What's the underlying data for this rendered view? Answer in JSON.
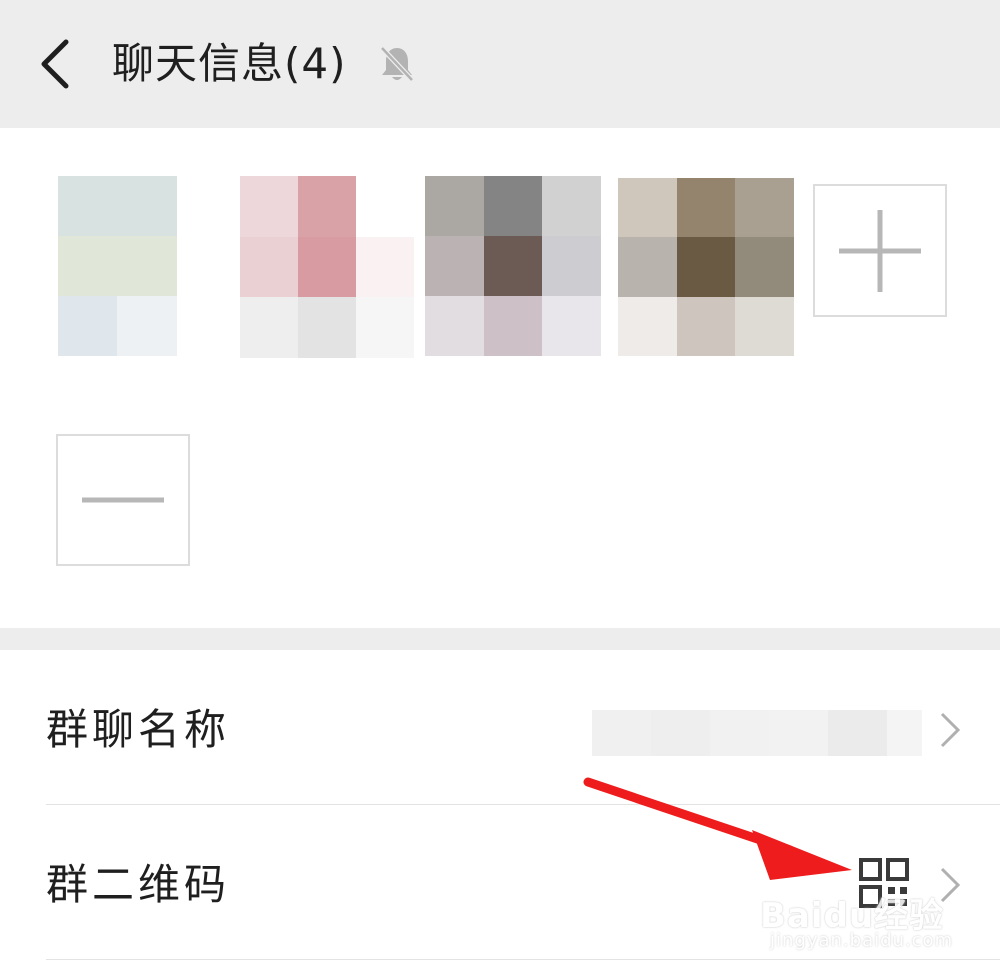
{
  "header": {
    "title": "聊天信息(4)",
    "back_icon": "chevron-left-icon",
    "mute_icon": "bell-muted-icon"
  },
  "members": {
    "add_icon": "plus-icon",
    "remove_icon": "minus-icon",
    "avatars": [
      {
        "colors": [
          "#d8e3e1",
          "#d8e3e1",
          "#ffffff",
          "#e0e6d8",
          "#e0e6d8",
          "#ffffff",
          "#dfe7ec",
          "#eef1f4",
          "#ffffff"
        ]
      },
      {
        "colors": [
          "#eed7da",
          "#d9a2a7",
          "#ffffff",
          "#ead0d3",
          "#d89ba1",
          "#faf1f2",
          "#efeeee",
          "#e3e3e3",
          "#f6f6f6"
        ]
      },
      {
        "colors": [
          "#aba7a2",
          "#848484",
          "#d1d1d1",
          "#bab2b3",
          "#6c5a54",
          "#cdccd0",
          "#e2dde0",
          "#cdc0c6",
          "#e8e6ea"
        ]
      },
      {
        "colors": [
          "#cfc6bc",
          "#94836d",
          "#a9a091",
          "#b9b3ad",
          "#6b5a43",
          "#928b7b",
          "#efebe8",
          "#cdc5be",
          "#dedbd4"
        ]
      }
    ]
  },
  "settings": {
    "group_name": {
      "label": "群聊名称"
    },
    "group_qr": {
      "label": "群二维码",
      "icon": "qr-code-icon"
    }
  },
  "watermark": {
    "brand": "Baidu经验",
    "url": "jingyan.baidu.com"
  },
  "annotation": {
    "arrow_color": "#ee1c1c"
  }
}
